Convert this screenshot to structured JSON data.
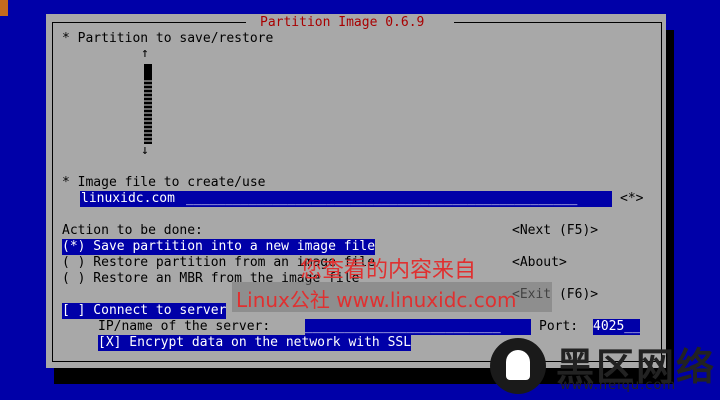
{
  "window": {
    "title": "Partition Image 0.6.9"
  },
  "partition_section": {
    "label": "* Partition to save/restore"
  },
  "image_section": {
    "label": "* Image file to create/use",
    "value": "linuxidc.com",
    "fill": "__________________________________________________",
    "browse_label": "<*>"
  },
  "action_section": {
    "label": "Action to be done:",
    "options": [
      {
        "text": "(*) Save partition into a new image file"
      },
      {
        "text": "( ) Restore partition from an image file"
      },
      {
        "text": "( ) Restore an MBR from the image file"
      }
    ]
  },
  "buttons": {
    "next": "<Next (F5)>",
    "about": "<About>",
    "exit": "<Exit (F6)>"
  },
  "server": {
    "connect": "[ ] Connect to server",
    "ip_label": "IP/name of the server:",
    "ip_value": "_________________________",
    "port_label": "Port:",
    "port_value": "4025__",
    "encrypt": "[X] Encrypt data on the network with SSL"
  },
  "watermark": {
    "line1": "您查看的内容来自",
    "line2": "Linux公社 www.linuxidc.com"
  },
  "logo": {
    "title": "黑区网络",
    "url": "www.heiqu.com"
  }
}
